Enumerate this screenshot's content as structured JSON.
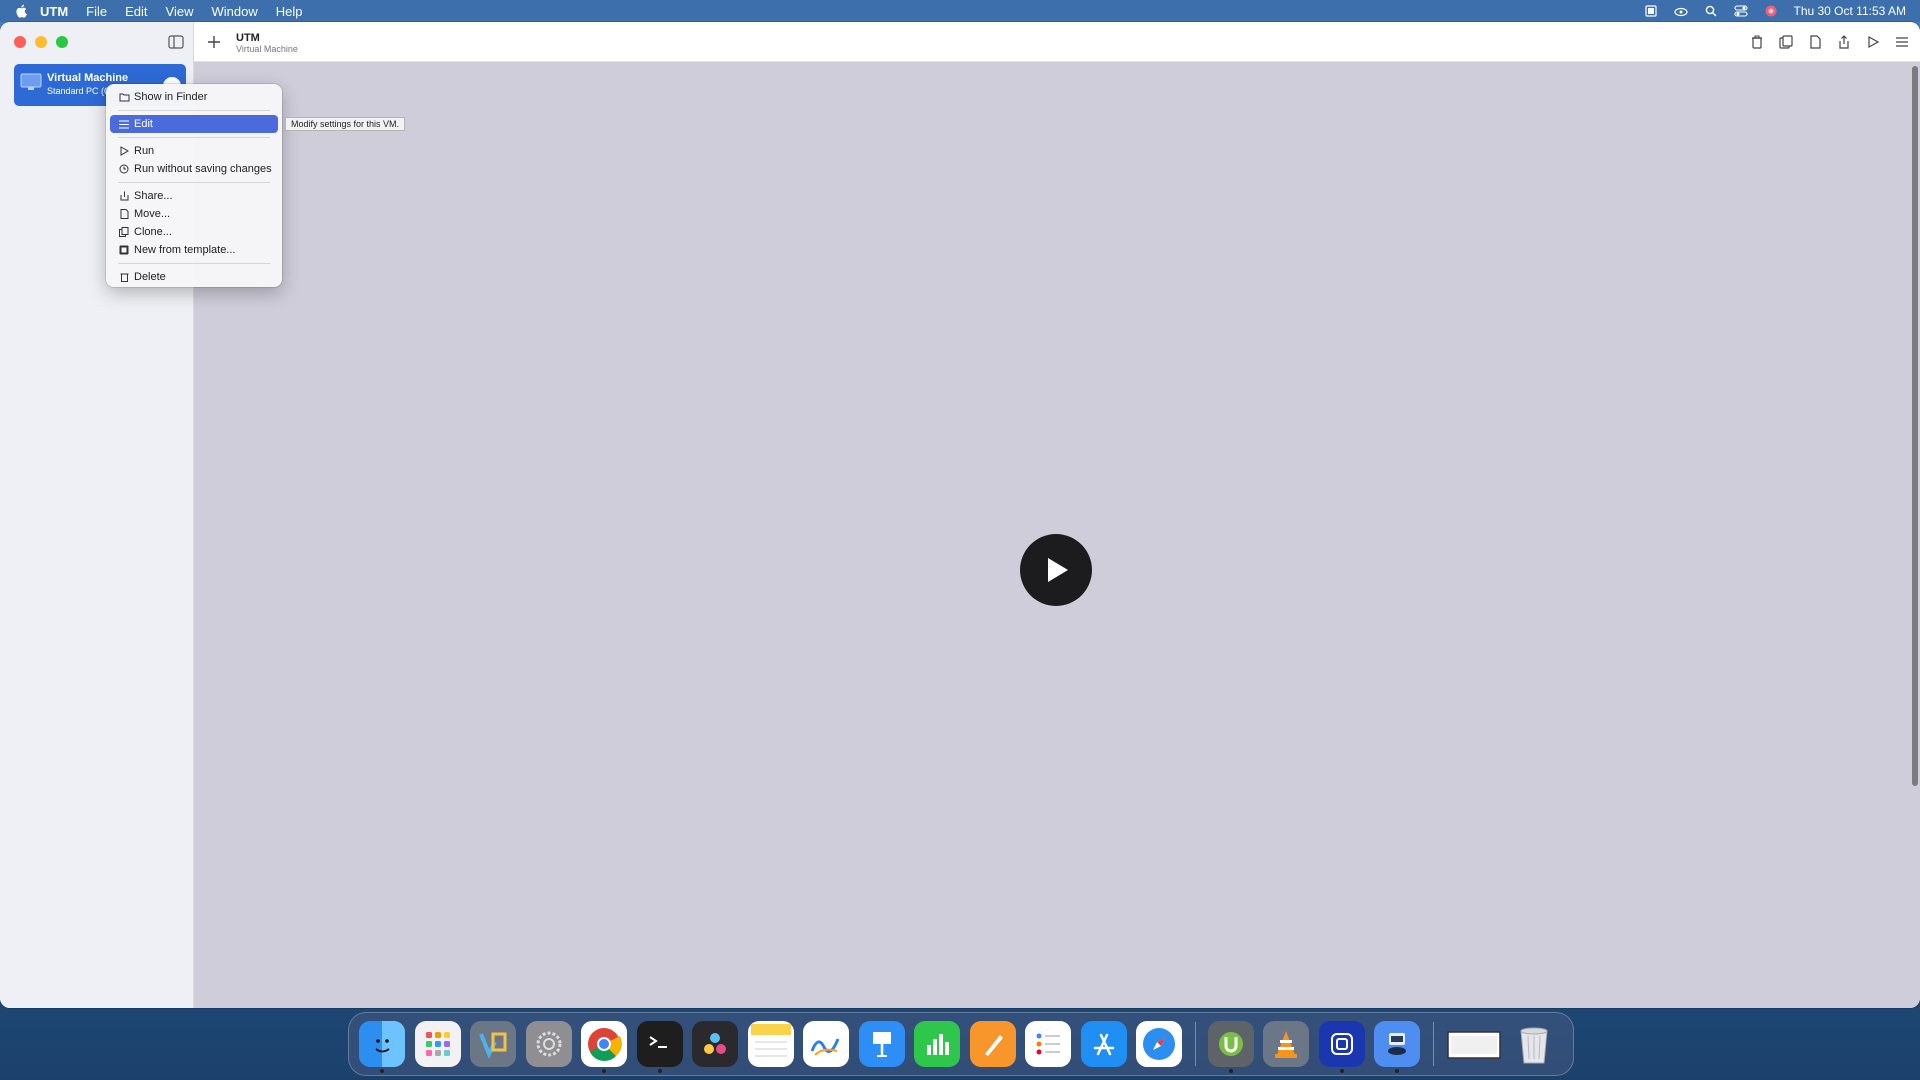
{
  "menubar": {
    "app_name": "UTM",
    "items": [
      "File",
      "Edit",
      "View",
      "Window",
      "Help"
    ],
    "clock": "Thu 30 Oct  11:53 AM"
  },
  "sidebar": {
    "vm": {
      "name": "Virtual Machine",
      "subtitle": "Standard PC (Q35 + ICH9, 2009)"
    }
  },
  "toolbar": {
    "title": "UTM",
    "subtitle": "Virtual Machine"
  },
  "context_menu": {
    "items": [
      {
        "label": "Show in Finder",
        "icon": "folder-icon"
      },
      {
        "label": "Edit",
        "icon": "list-icon",
        "selected": true
      },
      {
        "label": "Run",
        "icon": "play-icon"
      },
      {
        "label": "Run without saving changes",
        "icon": "clock-icon"
      },
      {
        "label": "Share...",
        "icon": "share-icon"
      },
      {
        "label": "Move...",
        "icon": "document-icon"
      },
      {
        "label": "Clone...",
        "icon": "copy-icon"
      },
      {
        "label": "New from template...",
        "icon": "template-icon"
      },
      {
        "label": "Delete",
        "icon": "trash-icon"
      }
    ]
  },
  "tooltip": "Modify settings for this VM.",
  "colors": {
    "accent": "#2e6ad6",
    "menu_selected": "#4b6bdd",
    "content_bg": "#cfcdd9"
  }
}
